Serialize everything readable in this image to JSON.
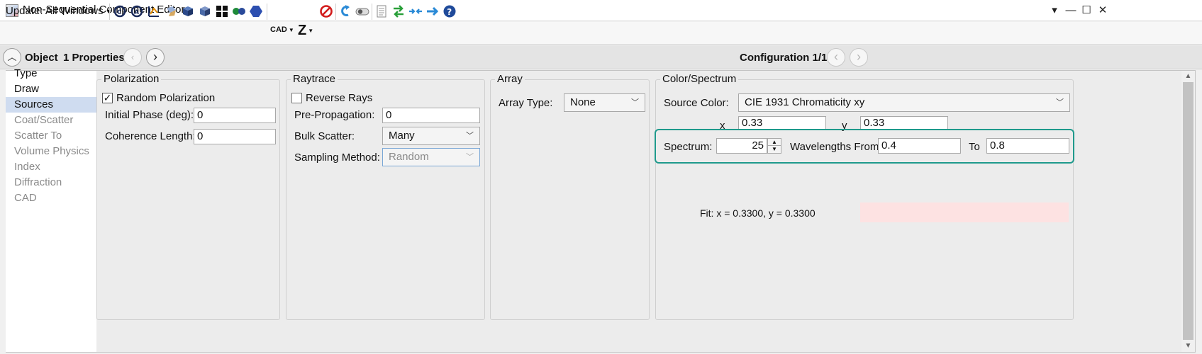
{
  "window": {
    "title": "Non-Sequential Component Editor",
    "controls": [
      "▾",
      "—",
      "☐",
      "✕"
    ]
  },
  "toolbar": {
    "update_label": "Update: All Windows",
    "cad_label": "CAD",
    "z_label": "Z"
  },
  "header": {
    "object_label": "Object",
    "properties_label": "1 Properties",
    "config_label": "Configuration 1/1"
  },
  "nav": {
    "items": [
      {
        "label": "Type",
        "state": "normal"
      },
      {
        "label": "Draw",
        "state": "normal"
      },
      {
        "label": "Sources",
        "state": "selected"
      },
      {
        "label": "Coat/Scatter",
        "state": "dim"
      },
      {
        "label": "Scatter To",
        "state": "dim"
      },
      {
        "label": "Volume Physics",
        "state": "dim"
      },
      {
        "label": "Index",
        "state": "dim"
      },
      {
        "label": "Diffraction",
        "state": "dim"
      },
      {
        "label": "CAD",
        "state": "dim"
      }
    ]
  },
  "polarization": {
    "title": "Polarization",
    "random_label": "Random Polarization",
    "random_checked": true,
    "phase_label": "Initial Phase (deg):",
    "phase_value": "0",
    "coherence_label": "Coherence Length:",
    "coherence_value": "0"
  },
  "raytrace": {
    "title": "Raytrace",
    "reverse_label": "Reverse Rays",
    "reverse_checked": false,
    "prepropagation_label": "Pre-Propagation:",
    "prepropagation_value": "0",
    "bulk_label": "Bulk Scatter:",
    "bulk_value": "Many",
    "sampling_label": "Sampling Method:",
    "sampling_value": "Random"
  },
  "array": {
    "title": "Array",
    "type_label": "Array Type:",
    "type_value": "None"
  },
  "color": {
    "title": "Color/Spectrum",
    "source_color_label": "Source Color:",
    "source_color_value": "CIE 1931 Chromaticity xy",
    "x_label": "x",
    "x_value": "0.33",
    "y_label": "y",
    "y_value": "0.33",
    "spectrum_label": "Spectrum:",
    "spectrum_value": "25",
    "wavelengths_from_label": "Wavelengths From",
    "wavelengths_from_value": "0.4",
    "to_label": "To",
    "to_value": "0.8",
    "fit_text": "Fit: x = 0.3300, y = 0.3300",
    "fit_swatch_color": "#fde2e2"
  },
  "colors": {
    "highlight": "#1f9a8c",
    "selected_nav": "#cfdcf0"
  }
}
